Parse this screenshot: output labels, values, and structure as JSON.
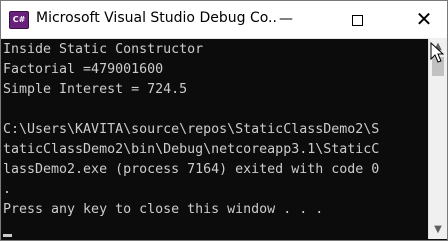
{
  "window": {
    "title": "Microsoft Visual Studio Debug Co...",
    "app_icon_text": "C#",
    "minimize_glyph": "—",
    "close_glyph": "✕"
  },
  "console": {
    "lines": [
      "Inside Static Constructor",
      "Factorial =479001600",
      "Simple Interest = 724.5",
      "",
      "C:\\Users\\KAVITA\\source\\repos\\StaticClassDemo2\\S",
      "taticClassDemo2\\bin\\Debug\\netcoreapp3.1\\StaticC",
      "lassDemo2.exe (process 7164) exited with code 0",
      ".",
      "Press any key to close this window . . ."
    ]
  },
  "scrollbar": {
    "up_glyph": "▲",
    "down_glyph": "▼"
  },
  "colors": {
    "console_bg": "#0c0c0c",
    "console_text": "#cccccc",
    "titlebar_bg": "#ffffff"
  }
}
